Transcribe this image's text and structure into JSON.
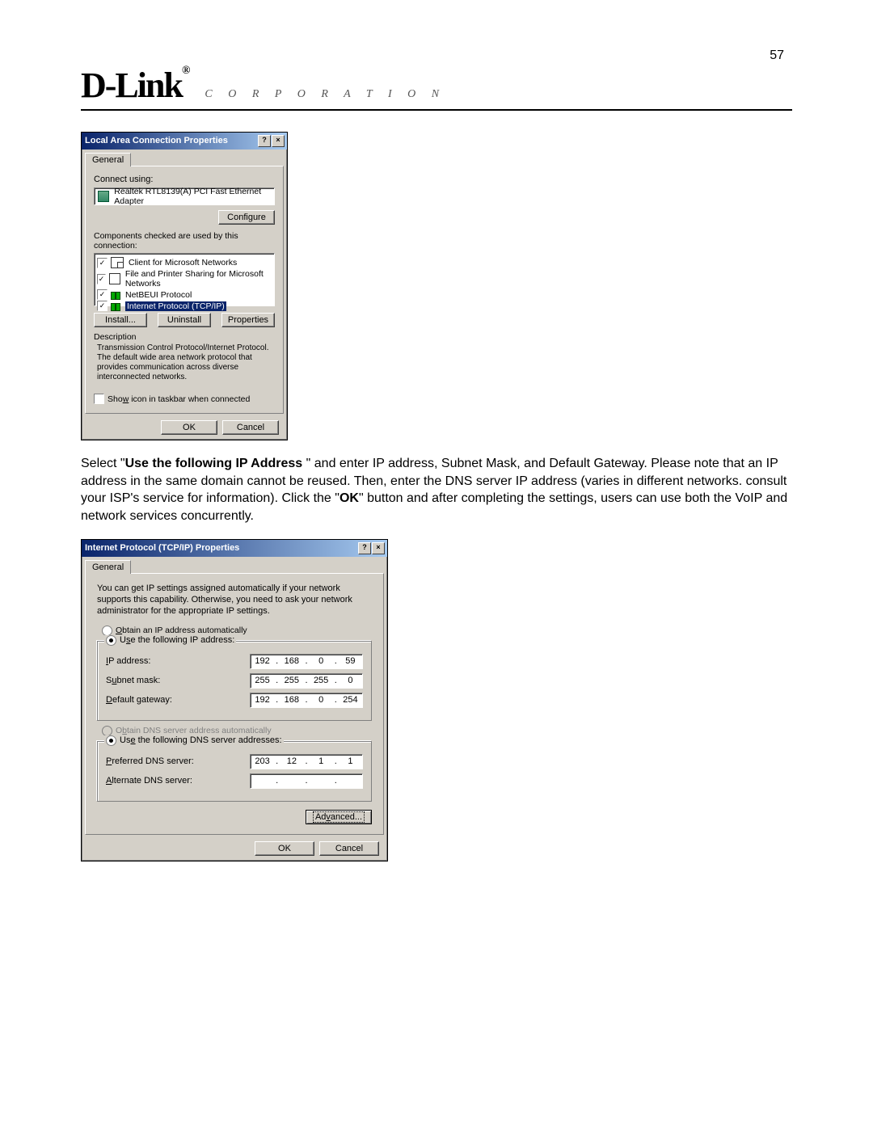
{
  "page_number": "57",
  "brand": "D-Link",
  "brand_reg": "®",
  "brand_sub": "C O R P O R A T I O N",
  "dialog1": {
    "title": "Local Area Connection Properties",
    "tab": "General",
    "connect_using_label": "Connect using:",
    "adapter": "Realtek RTL8139(A) PCI Fast Ethernet Adapter",
    "configure_btn": "Configure",
    "components_label": "Components checked are used by this connection:",
    "items": [
      "Client for Microsoft Networks",
      "File and Printer Sharing for Microsoft Networks",
      "NetBEUI Protocol",
      "Internet Protocol (TCP/IP)"
    ],
    "install_btn": "Install...",
    "uninstall_btn": "Uninstall",
    "properties_btn": "Properties",
    "desc_label": "Description",
    "desc_text": "Transmission Control Protocol/Internet Protocol. The default wide area network protocol that provides communication across diverse interconnected networks.",
    "show_icon": "Show icon in taskbar when connected",
    "ok": "OK",
    "cancel": "Cancel"
  },
  "paragraph": {
    "p1a": "Select \"",
    "p1b": "Use the following IP Address ",
    "p1c": "\" and enter IP address, Subnet Mask, and Default Gateway. Please note that an IP address in the same domain cannot be reused. Then, enter the DNS server IP address (varies in different networks. consult your ISP's service for information). Click the \"",
    "p1d": "OK",
    "p1e": "\" button and after completing the settings, users can use both the VoIP and network services concurrently."
  },
  "dialog2": {
    "title": "Internet Protocol (TCP/IP) Properties",
    "tab": "General",
    "intro": "You can get IP settings assigned automatically if your network supports this capability. Otherwise, you need to ask your network administrator for the appropriate IP settings.",
    "radio_auto_ip": "Obtain an IP address automatically",
    "radio_use_ip": "Use the following IP address:",
    "ip_label": "IP address:",
    "ip": [
      "192",
      "168",
      "0",
      "59"
    ],
    "mask_label": "Subnet mask:",
    "mask": [
      "255",
      "255",
      "255",
      "0"
    ],
    "gw_label": "Default gateway:",
    "gw": [
      "192",
      "168",
      "0",
      "254"
    ],
    "radio_auto_dns": "Obtain DNS server address automatically",
    "radio_use_dns": "Use the following DNS server addresses:",
    "pdns_label": "Preferred DNS server:",
    "pdns": [
      "203",
      "12",
      "1",
      "1"
    ],
    "adns_label": "Alternate DNS server:",
    "adns": [
      "",
      "",
      "",
      ""
    ],
    "advanced_btn": "Advanced...",
    "ok": "OK",
    "cancel": "Cancel"
  }
}
